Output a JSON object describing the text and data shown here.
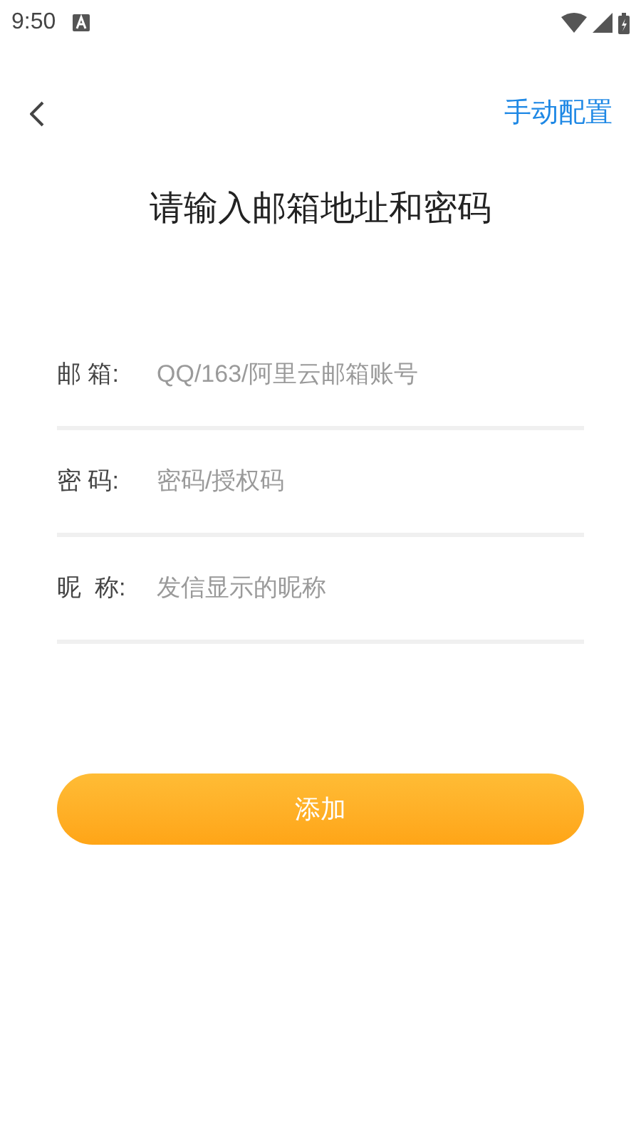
{
  "status_bar": {
    "time": "9:50"
  },
  "header": {
    "action": "手动配置"
  },
  "title": "请输入邮箱地址和密码",
  "fields": [
    {
      "label": "邮 箱:",
      "placeholder": "QQ/163/阿里云邮箱账号"
    },
    {
      "label": "密 码:",
      "placeholder": "密码/授权码"
    },
    {
      "label": "昵  称:",
      "placeholder": "发信显示的昵称"
    }
  ],
  "submit": "添加"
}
